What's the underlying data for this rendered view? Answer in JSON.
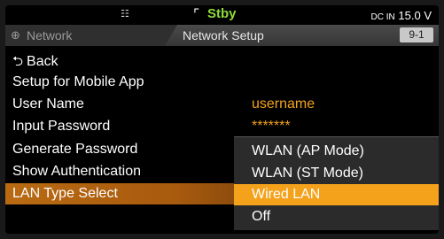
{
  "status_bar": {
    "network_icon": "network-icon",
    "record_icon": "record-icon",
    "state": "Stby",
    "power_label": "DC IN",
    "voltage": "15.0 V"
  },
  "header": {
    "parent_icon": "globe-icon",
    "parent_tab": "Network",
    "current_tab": "Network Setup",
    "page_number": "9-1"
  },
  "menu": {
    "back": "Back",
    "items": [
      {
        "label": "Setup for Mobile App",
        "value": ""
      },
      {
        "label": "User Name",
        "value": "username"
      },
      {
        "label": "Input Password",
        "value": "*******"
      },
      {
        "label": "Generate Password",
        "value": ""
      },
      {
        "label": "Show Authentication",
        "value": ""
      },
      {
        "label": "LAN Type Select",
        "value": ""
      }
    ],
    "selected_index": 5
  },
  "popup": {
    "options": [
      "WLAN (AP Mode)",
      "WLAN (ST Mode)",
      "Wired LAN",
      "Off"
    ],
    "active_index": 2
  },
  "colors": {
    "accent": "#f4a21c",
    "value_text": "#f3a21e",
    "standby": "#8fdc3a"
  }
}
